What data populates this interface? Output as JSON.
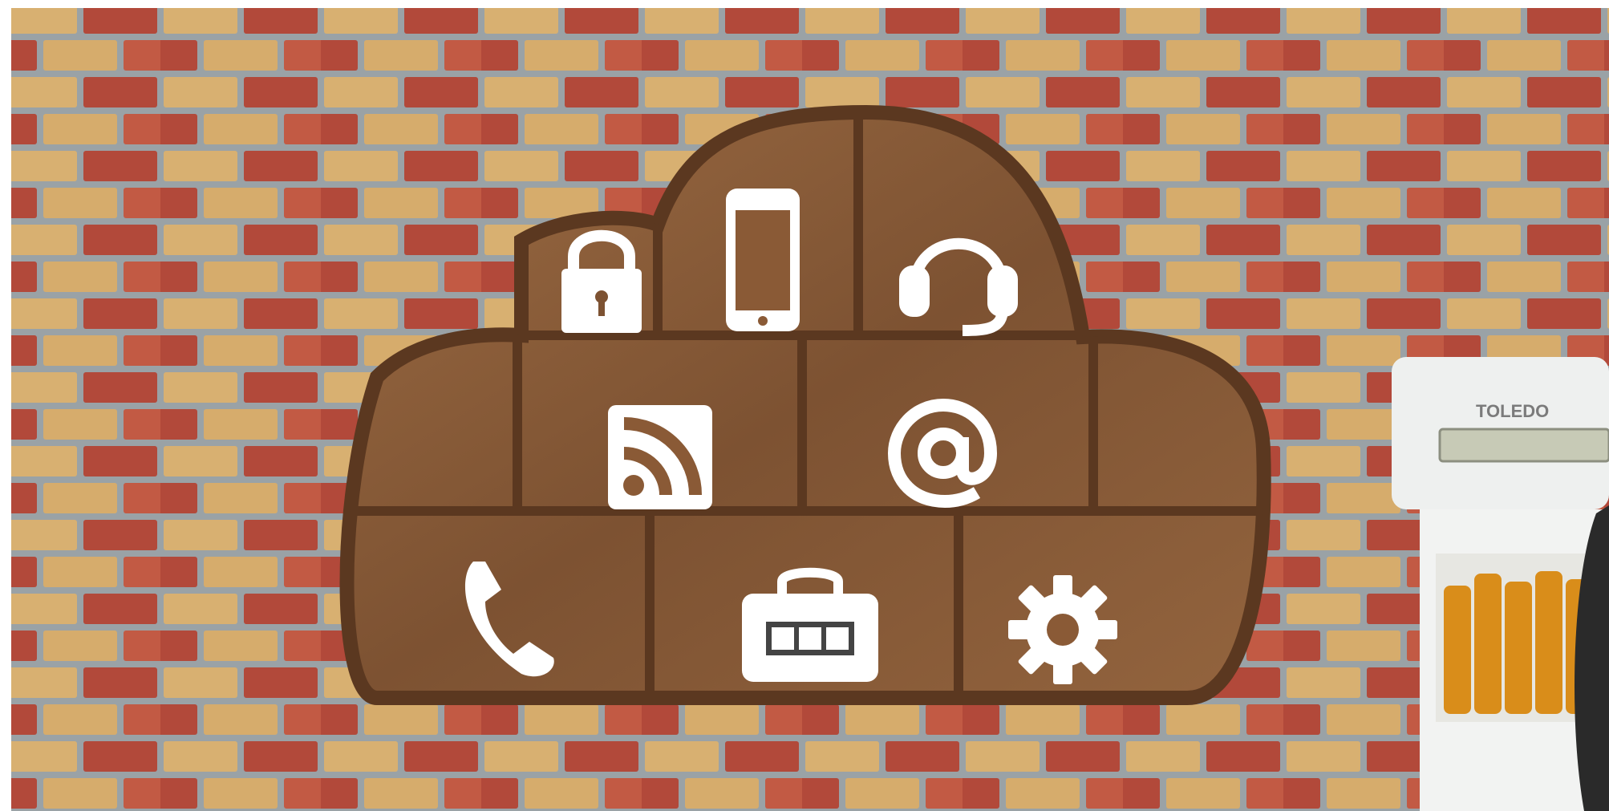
{
  "scene": {
    "subject": "cloud-shaped-wooden-shelf",
    "icons": [
      "padlock-icon",
      "smartphone-icon",
      "headset-icon",
      "rss-icon",
      "at-sign-icon",
      "phone-handset-icon",
      "briefcase-icon",
      "gear-icon"
    ],
    "colors": {
      "mortar": "#9aa2a6",
      "brick_red": "#b2493a",
      "brick_yellow": "#d8b071",
      "wood": "#8a5a36",
      "wood_dark": "#5b3820",
      "icon": "#ffffff"
    }
  },
  "machine": {
    "brand_text": "TOLEDO"
  }
}
